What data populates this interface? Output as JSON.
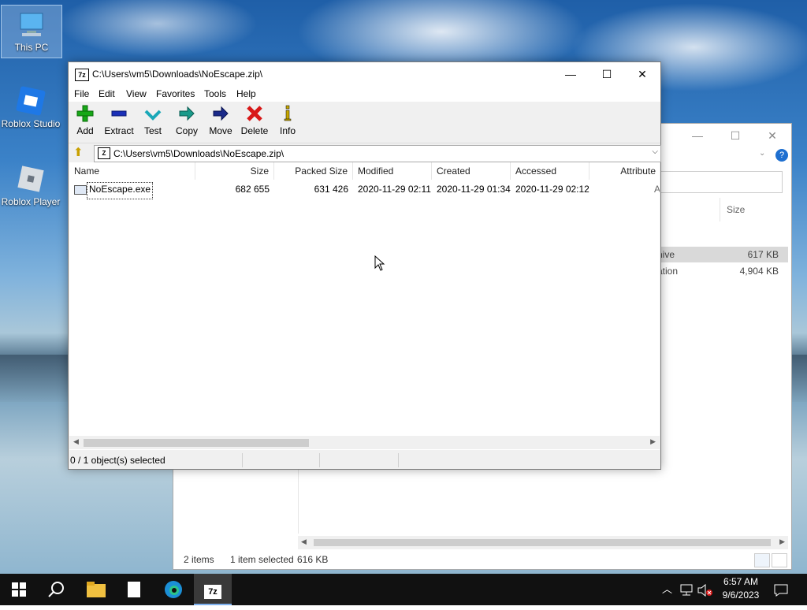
{
  "desktop": {
    "icons": [
      {
        "label": "This PC",
        "icon": "computer-icon"
      },
      {
        "label": "Roblox Studio",
        "icon": "roblox-studio-icon"
      },
      {
        "label": "Roblox Player",
        "icon": "roblox-player-icon"
      }
    ]
  },
  "explorer": {
    "column_size": "Size",
    "rows": [
      {
        "name_partial": "hive",
        "size": "617 KB"
      },
      {
        "name_partial": "ation",
        "size": "4,904 KB"
      }
    ],
    "status_items": "2 items",
    "status_selected": "1 item selected",
    "status_size": "616 KB"
  },
  "zip": {
    "window_title": "C:\\Users\\vm5\\Downloads\\NoEscape.zip\\",
    "menu": [
      "File",
      "Edit",
      "View",
      "Favorites",
      "Tools",
      "Help"
    ],
    "toolbar": [
      {
        "label": "Add",
        "icon": "plus-icon",
        "color": "#18a818"
      },
      {
        "label": "Extract",
        "icon": "minus-icon",
        "color": "#1a2fb8"
      },
      {
        "label": "Test",
        "icon": "check-icon",
        "color": "#1aa8b8"
      },
      {
        "label": "Copy",
        "icon": "copy-arrow-icon",
        "color": "#1a9a8a"
      },
      {
        "label": "Move",
        "icon": "move-arrow-icon",
        "color": "#1a2a8a"
      },
      {
        "label": "Delete",
        "icon": "x-icon",
        "color": "#d81818"
      },
      {
        "label": "Info",
        "icon": "info-icon",
        "color": "#c8a800"
      }
    ],
    "address": "C:\\Users\\vm5\\Downloads\\NoEscape.zip\\",
    "columns": [
      "Name",
      "Size",
      "Packed Size",
      "Modified",
      "Created",
      "Accessed",
      "Attribute"
    ],
    "files": [
      {
        "name": "NoEscape.exe",
        "size": "682 655",
        "packed_size": "631 426",
        "modified": "2020-11-29 02:11",
        "created": "2020-11-29 01:34",
        "accessed": "2020-11-29 02:12",
        "attributes": "A"
      }
    ],
    "status": "0 / 1 object(s) selected"
  },
  "taskbar": {
    "time": "6:57 AM",
    "date": "9/6/2023",
    "apps": [
      "start-icon",
      "search-icon",
      "file-explorer-icon",
      "notepad-icon",
      "edge-icon",
      "7zip-icon"
    ]
  }
}
